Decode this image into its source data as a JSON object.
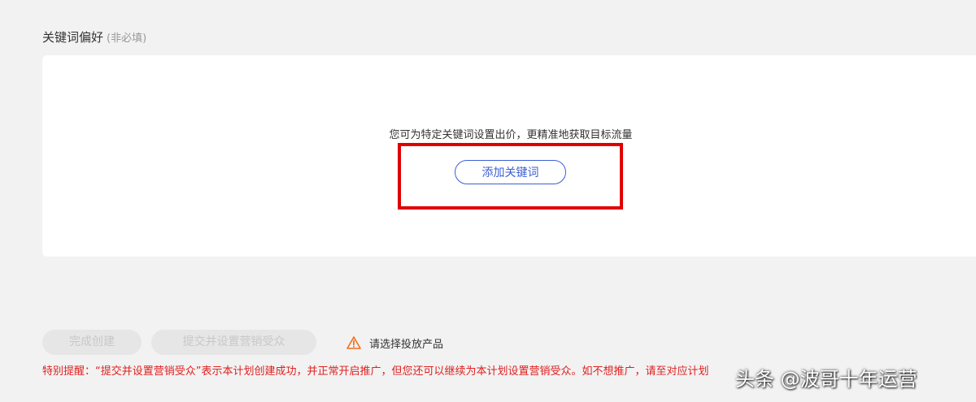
{
  "section": {
    "title": "关键词偏好",
    "hint": "(非必填)"
  },
  "card": {
    "description": "您可为特定关键词设置出价，更精准地获取目标流量",
    "add_button": "添加关键词"
  },
  "footer": {
    "complete_button": "完成创建",
    "submit_button": "提交并设置营销受众",
    "warning_text": "请选择投放产品",
    "notice": "特别提醒：“提交并设置营销受众”表示本计划创建成功，并正常开启推广，但您还可以继续为本计划设置营销受众。如不想推广，请至对应计划"
  },
  "watermark": "头条 @波哥十年运营",
  "colors": {
    "accent": "#3b5fd6",
    "highlight": "#e00000",
    "warning": "#f07020",
    "notice": "#e02020"
  },
  "icons": {
    "warning": "warning-triangle-icon"
  }
}
